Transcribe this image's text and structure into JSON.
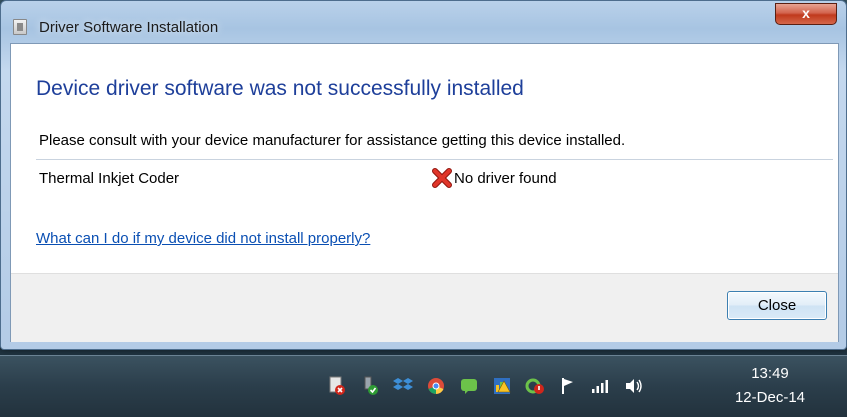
{
  "window": {
    "title": "Driver Software Installation",
    "close_glyph": "x"
  },
  "dialog": {
    "heading": "Device driver software was not successfully installed",
    "description": "Please consult with your device manufacturer for assistance getting this device installed.",
    "devices": [
      {
        "name": "Thermal Inkjet Coder",
        "status": "No driver found",
        "status_icon": "red-x-icon"
      }
    ],
    "help_link": "What can I do if my device did not install properly?",
    "close_button": "Close"
  },
  "taskbar": {
    "tray_icons": [
      "document-error-icon",
      "usb-device-check-icon",
      "dropbox-icon",
      "chrome-icon",
      "green-chat-icon",
      "warning-bars-icon",
      "sync-error-icon",
      "action-center-flag-icon",
      "network-signal-icon",
      "volume-icon"
    ],
    "clock_time": "13:49",
    "clock_date": "12-Dec-14"
  },
  "colors": {
    "heading": "#1e3f9a",
    "link": "#0a4fb3",
    "error_red": "#d0261b",
    "close_button_red": "#c0391c"
  }
}
